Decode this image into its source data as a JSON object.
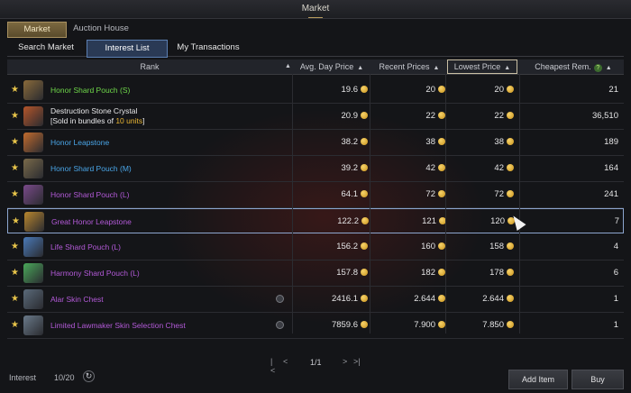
{
  "window": {
    "title": "Market"
  },
  "top_tabs": [
    {
      "label": "Market",
      "active": true
    },
    {
      "label": "Auction House",
      "active": false
    }
  ],
  "sub_tabs": [
    {
      "label": "Search Market",
      "active": false
    },
    {
      "label": "Interest List",
      "active": true
    },
    {
      "label": "My Transactions",
      "active": false
    }
  ],
  "columns": {
    "rank": "Rank",
    "avg_day_price": "Avg. Day Price",
    "recent_prices": "Recent Prices",
    "lowest_price": "Lowest Price",
    "cheapest_rem": "Cheapest Rem."
  },
  "rows": [
    {
      "name": "Honor Shard Pouch (S)",
      "color": "#6fd84a",
      "avg": "19.6",
      "recent": "20",
      "lowest": "20",
      "rem": "21",
      "icon_color": "#8a6a3a",
      "has_search": false
    },
    {
      "name": "Destruction Stone Crystal",
      "name_line2_prefix": "[Sold in bundles of ",
      "name_line2_highlight": "10 units",
      "name_line2_suffix": "]",
      "color": "#e8e8ea",
      "avg": "20.9",
      "recent": "22",
      "lowest": "22",
      "rem": "36,510",
      "icon_color": "#b5552a",
      "has_search": false
    },
    {
      "name": "Honor Leapstone",
      "color": "#4aa6e8",
      "avg": "38.2",
      "recent": "38",
      "lowest": "38",
      "rem": "189",
      "icon_color": "#c26b2e",
      "has_search": false
    },
    {
      "name": "Honor Shard Pouch (M)",
      "color": "#4aa6e8",
      "avg": "39.2",
      "recent": "42",
      "lowest": "42",
      "rem": "164",
      "icon_color": "#7a6a4a",
      "has_search": false
    },
    {
      "name": "Honor Shard Pouch (L)",
      "color": "#b35ad8",
      "avg": "64.1",
      "recent": "72",
      "lowest": "72",
      "rem": "241",
      "icon_color": "#7a4a8a",
      "has_search": false
    },
    {
      "name": "Great Honor Leapstone",
      "color": "#b35ad8",
      "avg": "122.2",
      "recent": "121",
      "lowest": "120",
      "rem": "7",
      "icon_color": "#b8862e",
      "has_search": false,
      "selected": true
    },
    {
      "name": "Life Shard Pouch (L)",
      "color": "#b35ad8",
      "avg": "156.2",
      "recent": "160",
      "lowest": "158",
      "rem": "4",
      "icon_color": "#4a7ab8",
      "has_search": false
    },
    {
      "name": "Harmony Shard Pouch (L)",
      "color": "#b35ad8",
      "avg": "157.8",
      "recent": "182",
      "lowest": "178",
      "rem": "6",
      "icon_color": "#4aa85a",
      "has_search": false
    },
    {
      "name": "Alar Skin Chest",
      "color": "#b35ad8",
      "avg": "2416.1",
      "recent": "2.644",
      "lowest": "2.644",
      "rem": "1",
      "icon_color": "#5a6a7a",
      "has_search": true
    },
    {
      "name": "Limited Lawmaker Skin Selection Chest",
      "color": "#b35ad8",
      "avg": "7859.6",
      "recent": "7.900",
      "lowest": "7.850",
      "rem": "1",
      "icon_color": "#6a7a8a",
      "has_search": true
    }
  ],
  "pager": {
    "page": "1/1"
  },
  "footer": {
    "interest_label": "Interest",
    "interest_count": "10/20",
    "add_item": "Add Item",
    "buy": "Buy"
  },
  "colors": {
    "accent": "#8da6cf",
    "coin": "#e8b534",
    "bg": "#141518"
  }
}
